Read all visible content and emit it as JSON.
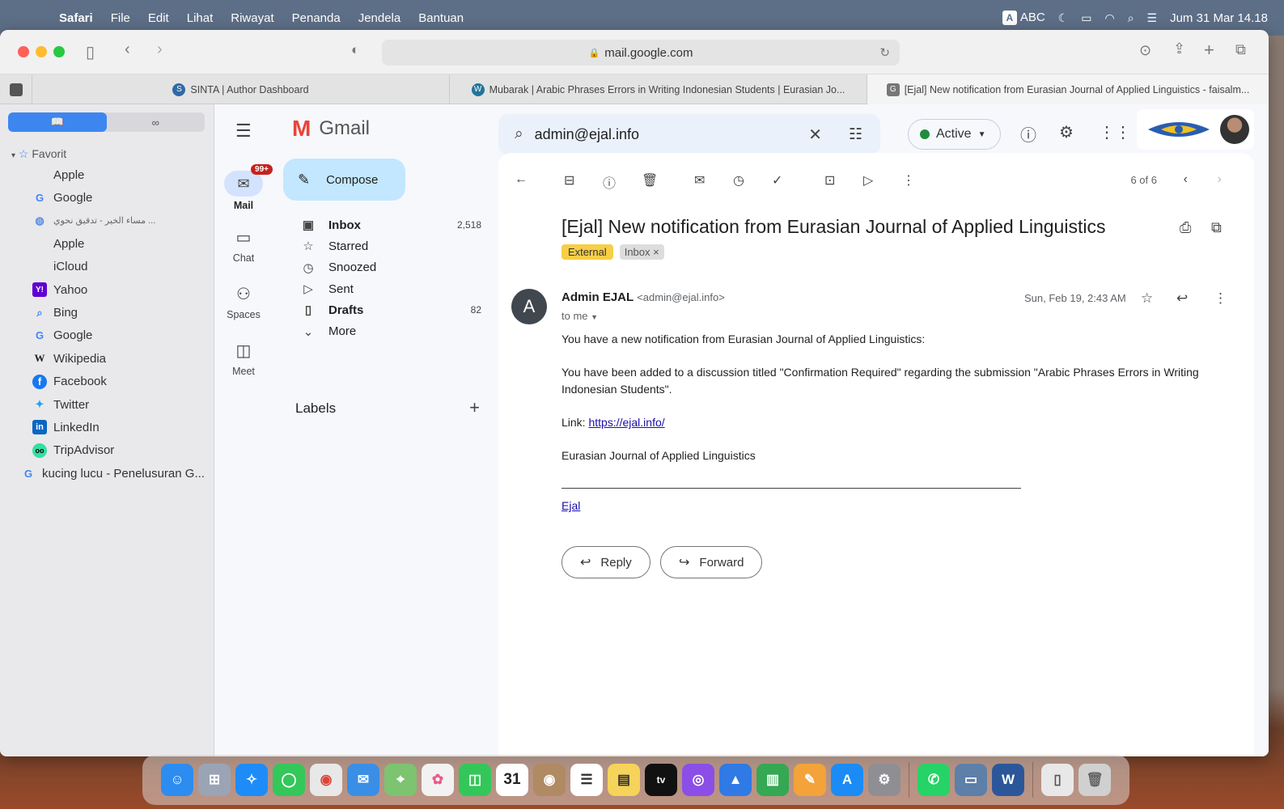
{
  "menubar": {
    "app": "Safari",
    "items": [
      "File",
      "Edit",
      "Lihat",
      "Riwayat",
      "Penanda",
      "Jendela",
      "Bantuan"
    ],
    "input_source": "ABC",
    "datetime": "Jum 31 Mar 14.18"
  },
  "safari": {
    "url": "mail.google.com",
    "tabs": [
      {
        "title": "SINTA | Author Dashboard"
      },
      {
        "title": "Mubarak | Arabic Phrases Errors in Writing Indonesian Students | Eurasian Jo..."
      },
      {
        "title": "[Ejal] New notification from Eurasian Journal of Applied Linguistics - faisalm..."
      }
    ],
    "sidebar": {
      "section": "Favorit",
      "items": [
        "Apple",
        "Google",
        "Apple",
        "iCloud",
        "Yahoo",
        "Bing",
        "Google",
        "Wikipedia",
        "Facebook",
        "Twitter",
        "LinkedIn",
        "TripAdvisor"
      ],
      "extra_item": "kucing lucu - Penelusuran G...",
      "arabic_item": "مساء الخير - تدقيق نحوي ..."
    }
  },
  "gmail": {
    "brand": "Gmail",
    "search_value": "admin@ejal.info",
    "status": "Active",
    "rail": {
      "mail": "Mail",
      "mail_badge": "99+",
      "chat": "Chat",
      "spaces": "Spaces",
      "meet": "Meet"
    },
    "compose": "Compose",
    "folders": [
      {
        "name": "Inbox",
        "count": "2,518",
        "bold": true
      },
      {
        "name": "Starred",
        "count": ""
      },
      {
        "name": "Snoozed",
        "count": ""
      },
      {
        "name": "Sent",
        "count": ""
      },
      {
        "name": "Drafts",
        "count": "82",
        "bold": true
      },
      {
        "name": "More",
        "count": ""
      }
    ],
    "labels_title": "Labels",
    "message": {
      "position": "6 of 6",
      "subject": "[Ejal] New notification from Eurasian Journal of Applied Linguistics",
      "tag_external": "External",
      "tag_inbox": "Inbox",
      "sender_initial": "A",
      "sender_name": "Admin EJAL",
      "sender_email": "<admin@ejal.info>",
      "to": "to me",
      "date": "Sun, Feb 19, 2:43 AM",
      "line1": "You have a new notification from Eurasian Journal of Applied Linguistics:",
      "line2": "You have been added to a discussion titled \"Confirmation Required\" regarding the submission \"Arabic Phrases Errors in Writing Indonesian Students\".",
      "link_label": "Link:",
      "link_url": "https://ejal.info/",
      "signature": "Eurasian Journal of Applied Linguistics",
      "sig_link": "Ejal",
      "reply": "Reply",
      "forward": "Forward"
    }
  },
  "colors": {
    "menubar": "#5d6f87",
    "gmail_bg": "#f6f8fc",
    "compose": "#c2e7ff",
    "external_tag": "#f7ce46",
    "active_dot": "#1e8e3e"
  }
}
